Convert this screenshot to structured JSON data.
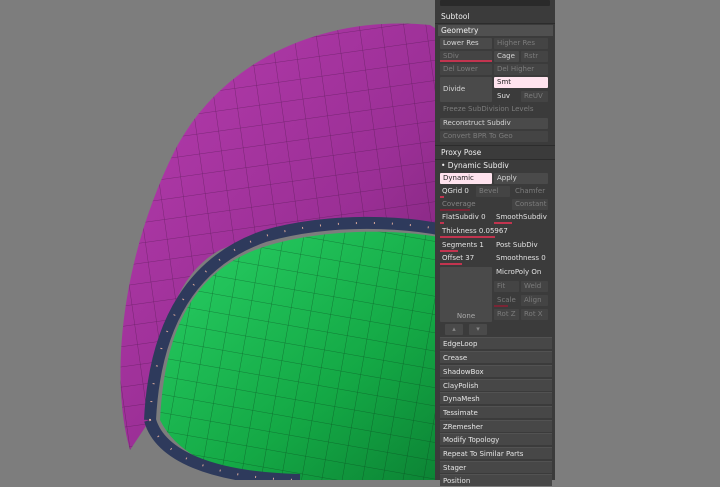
{
  "palette": {
    "subtool": "Subtool",
    "geometry": "Geometry",
    "lower_res": "Lower Res",
    "higher_res": "Higher Res",
    "sdiv": "SDiv",
    "cage": "Cage",
    "rstr": "Rstr",
    "del_lower": "Del Lower",
    "del_higher": "Del Higher",
    "divide": "Divide",
    "smt": "Smt",
    "suv": "Suv",
    "reuv": "ReUV",
    "freeze": "Freeze SubDivision Levels",
    "reconstruct": "Reconstruct Subdiv",
    "convert_bpr": "Convert BPR To Geo",
    "proxy_pose": "Proxy Pose",
    "dynamic_subdiv": "• Dynamic Subdiv",
    "dynamic": "Dynamic",
    "apply": "Apply",
    "qgrid": "QGrid 0",
    "bevel": "Bevel",
    "chamfer": "Chamfer",
    "coverage": "Coverage",
    "constant": "Constant",
    "flatsubdiv": "FlatSubdiv 0",
    "smoothsubdiv": "SmoothSubdiv",
    "thickness": "Thickness 0.05967",
    "segments": "Segments 1",
    "post_subdiv": "Post SubDiv",
    "offset": "Offset 37",
    "smoothness": "Smoothness 0",
    "micropoly": "MicroPoly On",
    "none": "None",
    "fit": "Fit",
    "weld": "Weld",
    "scale": "Scale",
    "align": "Align",
    "rotz": "Rot Z",
    "rotx": "Rot X",
    "menu": [
      "EdgeLoop",
      "Crease",
      "ShadowBox",
      "ClayPolish",
      "DynaMesh",
      "Tessimate",
      "ZRemesher",
      "Modify Topology",
      "Repeat To Similar Parts",
      "Stager",
      "Position"
    ]
  },
  "colors": {
    "mesh_outer": "#a0329a",
    "mesh_inner": "#1ec052",
    "rim": "#2e3a5c",
    "background": "#7d7d7d",
    "slider": "#c2344f"
  }
}
